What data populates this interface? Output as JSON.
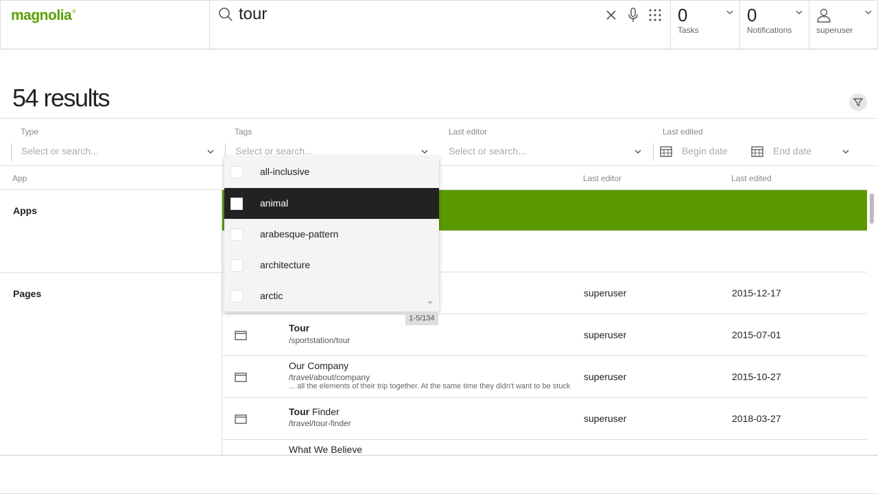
{
  "header": {
    "logo": "magnolia",
    "logo_mark": "®",
    "search": {
      "value": "tour",
      "placeholder": ""
    },
    "tasks": {
      "count": "0",
      "label": "Tasks"
    },
    "notifications": {
      "count": "0",
      "label": "Notifications"
    },
    "user": {
      "name": "superuser"
    }
  },
  "results": {
    "title": "54 results"
  },
  "filters": {
    "type": {
      "label": "Type",
      "placeholder": "Select or search..."
    },
    "tags": {
      "label": "Tags",
      "placeholder": "Select or search..."
    },
    "last_editor": {
      "label": "Last editor",
      "placeholder": "Select or search..."
    },
    "last_edited": {
      "label": "Last edited",
      "begin_placeholder": "Begin date",
      "end_placeholder": "End date"
    }
  },
  "table": {
    "columns": {
      "app": "App",
      "last_editor": "Last editor",
      "last_edited": "Last edited"
    },
    "sections": {
      "apps": "Apps",
      "pages": "Pages"
    },
    "rows": [
      {
        "title_bold": "",
        "title_rest": "",
        "path": "",
        "snippet": "",
        "editor": "superuser",
        "date": "2015-12-17"
      },
      {
        "title_bold": "Tour",
        "title_rest": "",
        "path": "/sportstation/tour",
        "snippet": "",
        "editor": "superuser",
        "date": "2015-07-01"
      },
      {
        "title_bold": "",
        "title_rest": "Our Company",
        "path": "/travel/about/company",
        "snippet": "... all the elements of their trip together. At the same time they didn't want to be stuck",
        "editor": "superuser",
        "date": "2015-10-27"
      },
      {
        "title_bold": "Tour",
        "title_rest": " Finder",
        "path": "/travel/tour-finder",
        "snippet": "",
        "editor": "superuser",
        "date": "2018-03-27"
      },
      {
        "title_bold": "",
        "title_rest": "What We Believe",
        "path": "",
        "snippet": "",
        "editor": "",
        "date": ""
      }
    ]
  },
  "tags_dropdown": {
    "items": [
      "all-inclusive",
      "animal",
      "arabesque-pattern",
      "architecture",
      "arctic"
    ],
    "selected_index": 1,
    "count": "1-5/134"
  },
  "colors": {
    "brand": "#5aa000",
    "highlight_row": "#5a9a00",
    "selected_item": "#222222"
  }
}
